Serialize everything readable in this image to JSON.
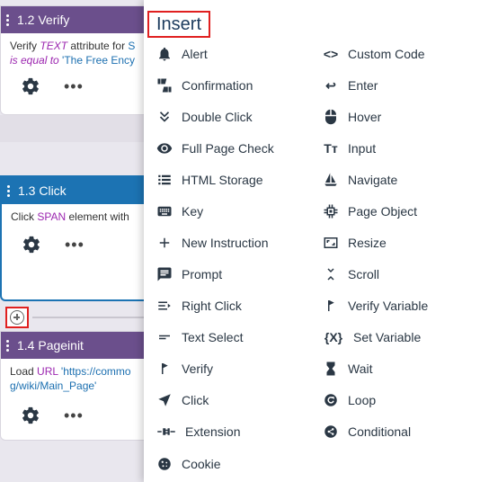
{
  "cards": {
    "verify": {
      "title": "1.2 Verify",
      "text_prefix": "Verify ",
      "kw1": "TEXT",
      "text_mid": " attribute for ",
      "kw_frag": "S",
      "kw2": "is equal to",
      "value": "'The Free Ency"
    },
    "click": {
      "title": "1.3 Click",
      "text_prefix": "Click ",
      "kw": "SPAN",
      "text_suffix": " element with"
    },
    "pageinit": {
      "title": "1.4 Pageinit",
      "text_prefix": "Load ",
      "kw": "URL",
      "value1": " 'https://commo",
      "value2": "g/wiki/Main_Page'"
    }
  },
  "more_label": "•••",
  "menu": {
    "title": "Insert",
    "left": [
      {
        "label": "Alert",
        "icon": "bell-icon"
      },
      {
        "label": "Confirmation",
        "icon": "thumbs-icon"
      },
      {
        "label": "Double Click",
        "icon": "double-chevron-icon"
      },
      {
        "label": "Full Page Check",
        "icon": "eye-icon"
      },
      {
        "label": "HTML Storage",
        "icon": "list-icon"
      },
      {
        "label": "Key",
        "icon": "keyboard-icon"
      },
      {
        "label": "New Instruction",
        "icon": "plus-icon"
      },
      {
        "label": "Prompt",
        "icon": "chat-icon"
      },
      {
        "label": "Right Click",
        "icon": "right-click-icon"
      },
      {
        "label": "Text Select",
        "icon": "text-select-icon"
      },
      {
        "label": "Verify",
        "icon": "flag-icon"
      },
      {
        "label": "Click",
        "icon": "cursor-icon"
      },
      {
        "label": "Extension",
        "icon": "plug-icon"
      },
      {
        "label": "Cookie",
        "icon": "cookie-icon"
      }
    ],
    "right": [
      {
        "label": "Custom Code",
        "icon": "code-icon",
        "glyph": "<>"
      },
      {
        "label": "Enter",
        "icon": "enter-icon",
        "glyph": "↩"
      },
      {
        "label": "Hover",
        "icon": "mouse-icon"
      },
      {
        "label": "Input",
        "icon": "text-size-icon",
        "glyph": "Tт"
      },
      {
        "label": "Navigate",
        "icon": "sailboat-icon"
      },
      {
        "label": "Page Object",
        "icon": "chip-icon"
      },
      {
        "label": "Resize",
        "icon": "resize-icon"
      },
      {
        "label": "Scroll",
        "icon": "scroll-icon"
      },
      {
        "label": "Verify Variable",
        "icon": "flag-icon"
      },
      {
        "label": "Set Variable",
        "icon": "variable-icon",
        "glyph": "{X}"
      },
      {
        "label": "Wait",
        "icon": "hourglass-icon"
      },
      {
        "label": "Loop",
        "icon": "loop-icon"
      },
      {
        "label": "Conditional",
        "icon": "share-icon"
      }
    ]
  },
  "colors": {
    "purple_header": "#6b4f8c",
    "blue_header": "#1c73b3",
    "highlight": "#e02020",
    "menu_text": "#2a3744"
  }
}
